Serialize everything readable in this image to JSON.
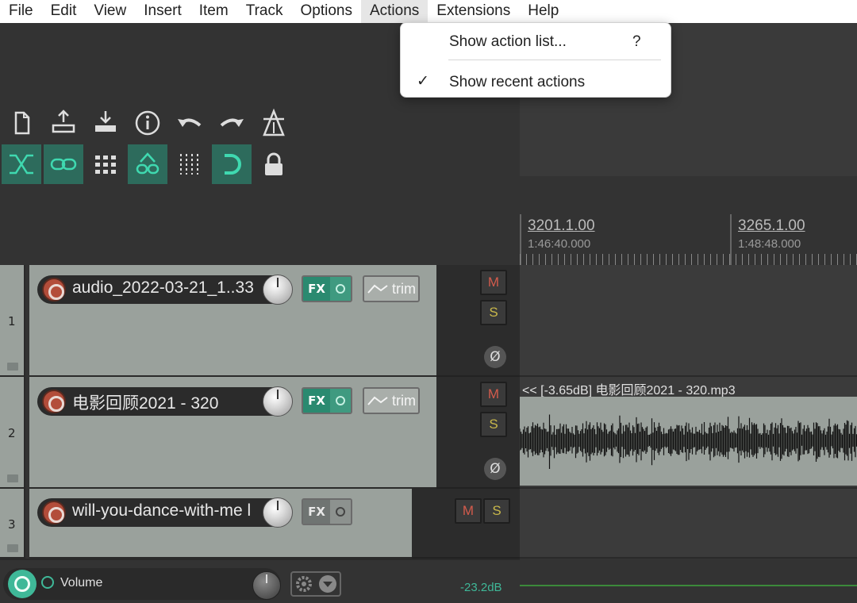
{
  "menubar": {
    "items": [
      "File",
      "Edit",
      "View",
      "Insert",
      "Item",
      "Track",
      "Options",
      "Actions",
      "Extensions",
      "Help"
    ]
  },
  "actions_menu": {
    "show_action_list": "Show action list...",
    "show_action_list_shortcut": "?",
    "show_recent_actions": "Show recent actions",
    "show_recent_checked": "✓"
  },
  "ruler": {
    "mark1_bars": "3201.1.00",
    "mark1_time": "1:46:40.000",
    "mark2_bars": "3265.1.00",
    "mark2_time": "1:48:48.000"
  },
  "tracks": [
    {
      "number": "1",
      "name": "audio_2022-03-21_1..33",
      "fx": "FX",
      "trim": "trim",
      "mute": "M",
      "solo": "S",
      "phase": "Ø"
    },
    {
      "number": "2",
      "name": "电影回顾2021 - 320",
      "fx": "FX",
      "trim": "trim",
      "mute": "M",
      "solo": "S",
      "phase": "Ø"
    },
    {
      "number": "3",
      "name": "will-you-dance-with-me l",
      "fx": "FX",
      "mute": "M",
      "solo": "S"
    }
  ],
  "media_item": {
    "label": "<< [-3.65dB] 电影回顾2021 - 320.mp3"
  },
  "master": {
    "volume_label": "Volume",
    "db": "-23.2dB"
  },
  "colors": {
    "accent": "#2d6b5c",
    "record": "#b34d3a",
    "master_green": "#3fb898"
  }
}
